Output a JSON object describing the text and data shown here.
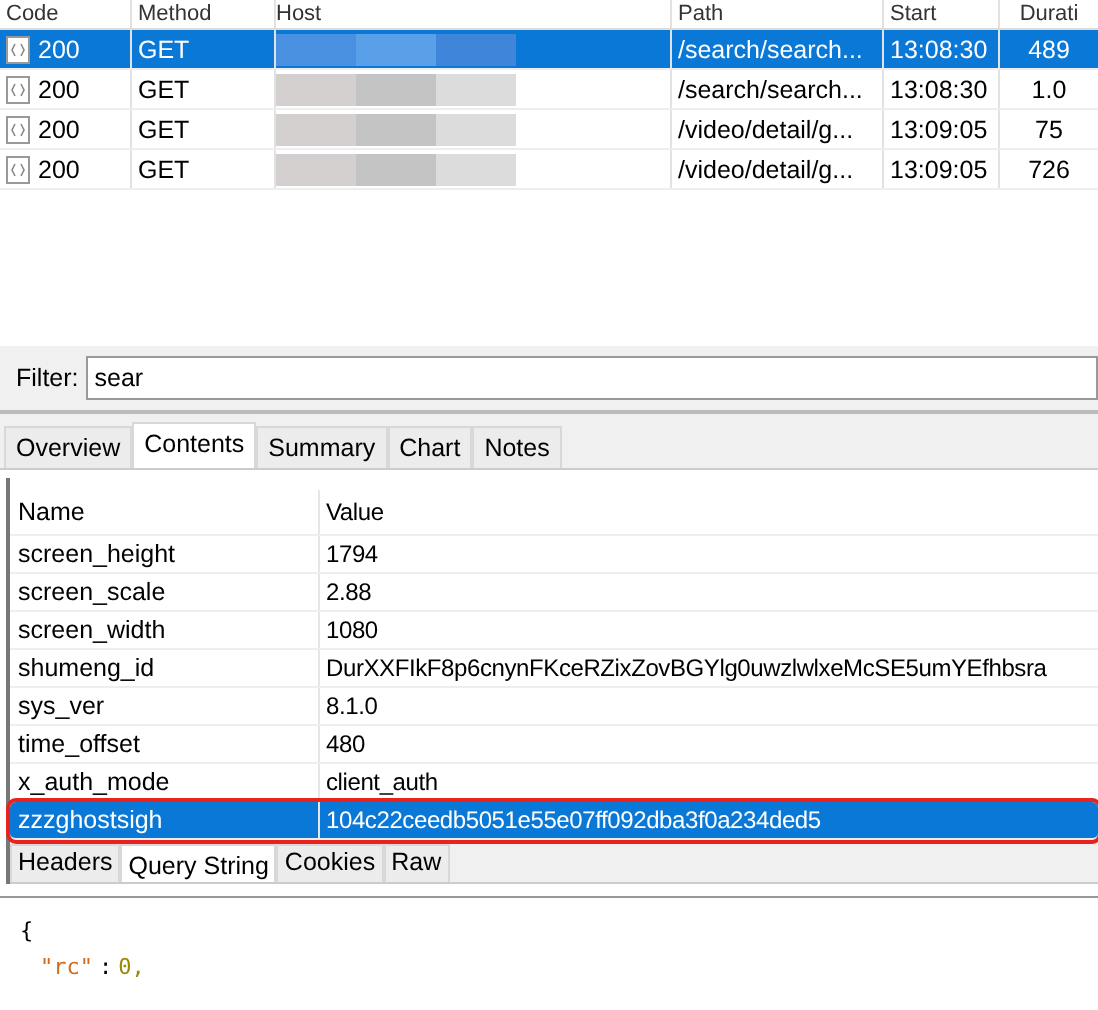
{
  "sessions": {
    "columns": [
      "Code",
      "Method",
      "Host",
      "Path",
      "Start",
      "Durati"
    ],
    "rows": [
      {
        "code": "200",
        "method": "GET",
        "path": "/search/search...",
        "start": "13:08:30",
        "duration": "489",
        "selected": true
      },
      {
        "code": "200",
        "method": "GET",
        "path": "/search/search...",
        "start": "13:08:30",
        "duration": "1.0",
        "selected": false
      },
      {
        "code": "200",
        "method": "GET",
        "path": "/video/detail/g...",
        "start": "13:09:05",
        "duration": "75",
        "selected": false
      },
      {
        "code": "200",
        "method": "GET",
        "path": "/video/detail/g...",
        "start": "13:09:05",
        "duration": "726",
        "selected": false
      }
    ]
  },
  "filter": {
    "label": "Filter:",
    "value": "sear"
  },
  "tabs": [
    {
      "label": "Overview",
      "selected": false
    },
    {
      "label": "Contents",
      "selected": true
    },
    {
      "label": "Summary",
      "selected": false
    },
    {
      "label": "Chart",
      "selected": false
    },
    {
      "label": "Notes",
      "selected": false
    }
  ],
  "params": {
    "columns": [
      "Name",
      "Value"
    ],
    "rows": [
      {
        "name": "screen_height",
        "value": "1794",
        "selected": false,
        "highlighted": false
      },
      {
        "name": "screen_scale",
        "value": "2.88",
        "selected": false,
        "highlighted": false
      },
      {
        "name": "screen_width",
        "value": "1080",
        "selected": false,
        "highlighted": false
      },
      {
        "name": "shumeng_id",
        "value": "DurXXFIkF8p6cnynFKceRZixZovBGYlg0uwzlwlxeMcSE5umYEfhbsra",
        "selected": false,
        "highlighted": false
      },
      {
        "name": "sys_ver",
        "value": "8.1.0",
        "selected": false,
        "highlighted": false
      },
      {
        "name": "time_offset",
        "value": "480",
        "selected": false,
        "highlighted": false
      },
      {
        "name": "x_auth_mode",
        "value": "client_auth",
        "selected": false,
        "highlighted": false
      },
      {
        "name": "zzzghostsigh",
        "value": "104c22ceedb5051e55e07ff092dba3f0a234ded5",
        "selected": true,
        "highlighted": true
      }
    ]
  },
  "subtabs": [
    {
      "label": "Headers",
      "selected": false
    },
    {
      "label": "Query String",
      "selected": true
    },
    {
      "label": "Cookies",
      "selected": false
    },
    {
      "label": "Raw",
      "selected": false
    }
  ],
  "body": {
    "lines": [
      {
        "kind": "brace",
        "text": "{"
      },
      {
        "kind": "pair",
        "key": "\"rc\"",
        "sep": ":",
        "value": "0,"
      }
    ]
  }
}
